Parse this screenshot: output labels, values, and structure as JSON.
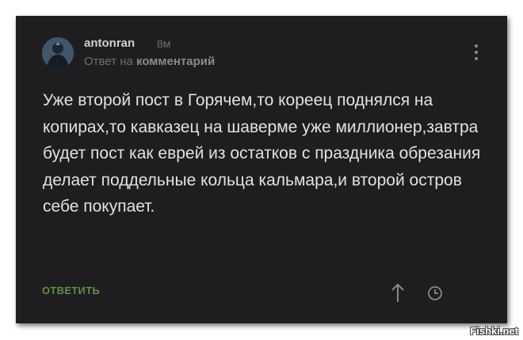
{
  "comment": {
    "author": "antonran",
    "time": "8м",
    "reply_prefix": "Ответ на",
    "reply_target": "комментарий",
    "text": "Уже второй пост в Горячем,то кореец поднялся на копирах,то кавказец на шаверме уже миллионер,завтра будет пост как еврей из остатков с праздника обрезания делает поддельные кольца кальмара,и второй остров себе покупает.",
    "reply_label": "ОТВЕТИТЬ"
  },
  "icons": {
    "avatar": "avatar-image",
    "menu": "more-vertical-icon",
    "up": "arrow-up-icon",
    "clock": "clock-icon"
  },
  "watermark": "Fishki.net",
  "colors": {
    "card_background": "#1e1e20",
    "text": "#e2e2e2",
    "muted": "#6e6e6e",
    "reply_accent": "#5f8f48"
  }
}
